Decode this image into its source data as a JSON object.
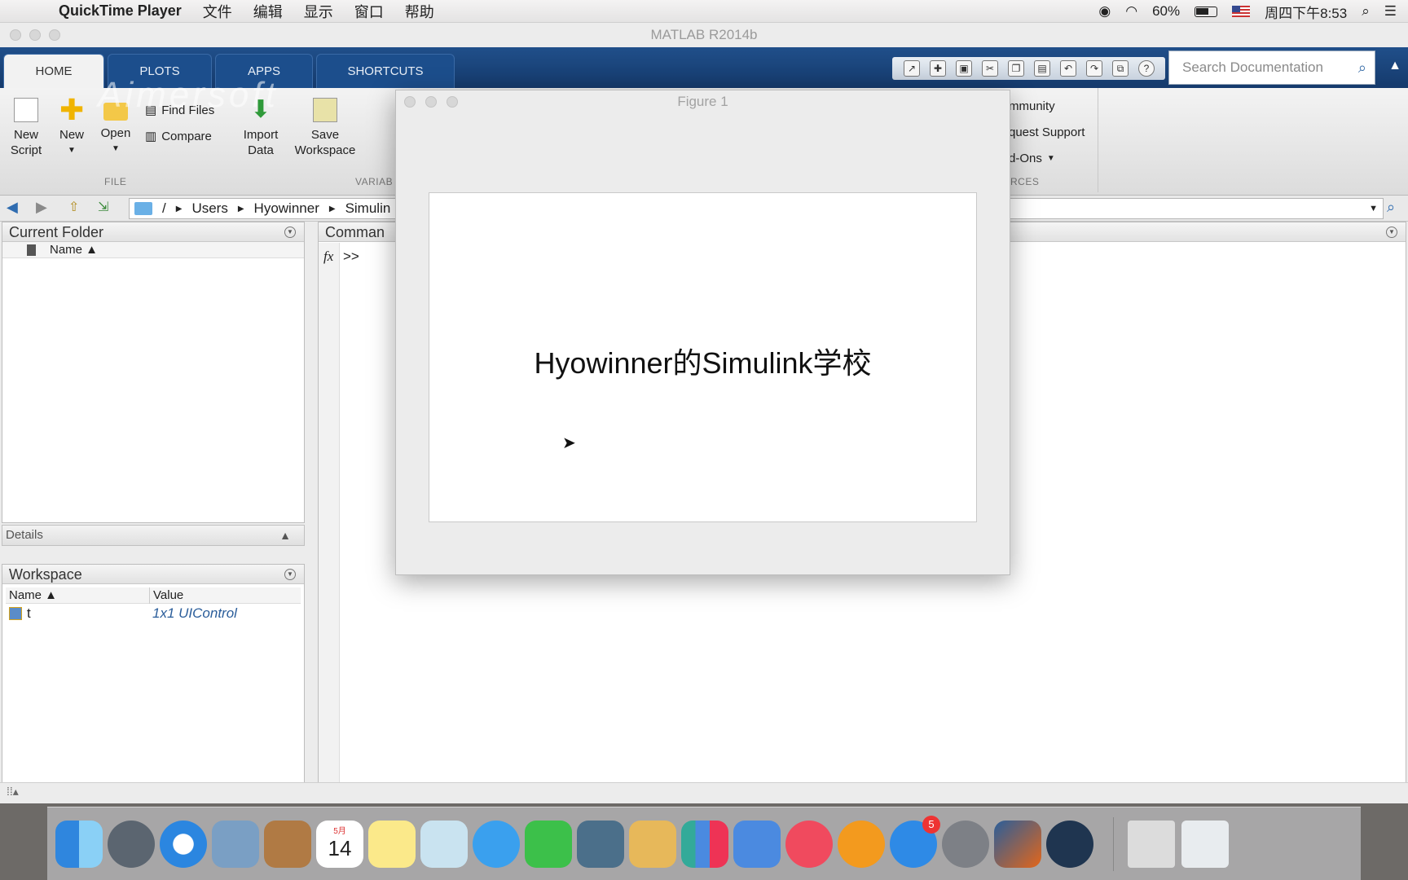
{
  "menubar": {
    "app_name": "QuickTime Player",
    "items": [
      "文件",
      "编辑",
      "显示",
      "窗口",
      "帮助"
    ],
    "battery": "60%",
    "clock": "周四下午8:53"
  },
  "matlab": {
    "title": "MATLAB R2014b",
    "tabs": [
      "HOME",
      "PLOTS",
      "APPS",
      "SHORTCUTS"
    ],
    "search_placeholder": "Search Documentation",
    "ribbon": {
      "new_script": "New\nScript",
      "new": "New",
      "open": "Open",
      "find_files": "Find Files",
      "compare": "Compare",
      "import_data": "Import\nData",
      "save_workspace": "Save\nWorkspace",
      "file_group": "FILE",
      "variable_group": "VARIAB",
      "community": "mmunity",
      "request_support": "quest Support",
      "addons": "d-Ons",
      "resources_group": "RCES"
    },
    "path": [
      "/",
      "Users",
      "Hyowinner",
      "Simulin"
    ],
    "current_folder": {
      "title": "Current Folder",
      "col_name": "Name ▲"
    },
    "details": "Details",
    "workspace": {
      "title": "Workspace",
      "col_name": "Name ▲",
      "col_value": "Value",
      "rows": [
        {
          "name": "t",
          "value": "1x1 UIControl"
        }
      ]
    },
    "command": {
      "title": "Comman",
      "prompt": ">>",
      "fx": "fx"
    }
  },
  "figure": {
    "title": "Figure 1",
    "text": "Hyowinner的Simulink学校"
  },
  "watermark": "Aimersoft",
  "dock": {
    "calendar_month": "5月",
    "calendar_day": "14",
    "appstore_badge": "5"
  }
}
